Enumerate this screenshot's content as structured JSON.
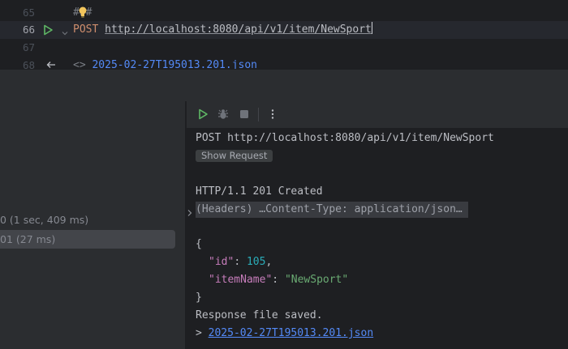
{
  "editor": {
    "lines": [
      {
        "num": "65",
        "text": "###"
      },
      {
        "num": "66",
        "method": "POST",
        "url": "http://localhost:8080/api/v1/item/NewSport"
      },
      {
        "num": "67",
        "text": ""
      },
      {
        "num": "68",
        "prefix": "<> ",
        "link": "2025-02-27T195013.201.json"
      }
    ]
  },
  "history": {
    "items": [
      {
        "label": "0 (1 sec, 409 ms)"
      },
      {
        "label": "01 (27 ms)"
      }
    ]
  },
  "response": {
    "request_line": "POST http://localhost:8080/api/v1/item/NewSport",
    "show_request_label": "Show Request",
    "status_line": "HTTP/1.1 201 Created",
    "headers_line": "(Headers) …Content-Type: application/json…",
    "body": {
      "open_brace": "{",
      "id_key": "\"id\"",
      "id_value": "105",
      "item_key": "\"itemName\"",
      "item_value": "\"NewSport\"",
      "close_brace": "}"
    },
    "saved_text": "Response file saved.",
    "saved_prefix": "> ",
    "saved_link": "2025-02-27T195013.201.json"
  },
  "colors": {
    "run_green": "#5fb865",
    "accent_link": "#548af7",
    "keyword": "#cf8e6d"
  }
}
